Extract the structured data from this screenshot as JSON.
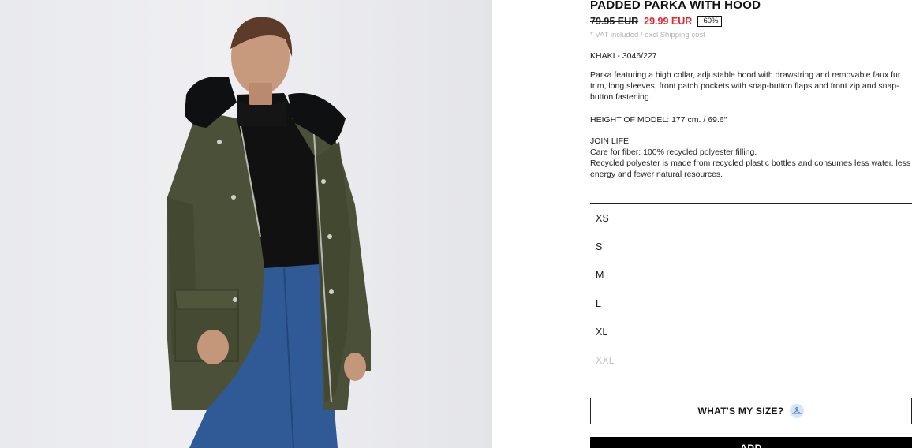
{
  "product": {
    "title": "PADDED PARKA WITH HOOD",
    "old_price": "79.95 EUR",
    "sale_price": "29.99 EUR",
    "discount": "-60%",
    "vat_note": "* VAT included / excl Shipping cost",
    "color_ref": "KHAKI - 3046/227",
    "description": "Parka featuring a high collar, adjustable hood with drawstring and removable faux fur trim, long sleeves, front patch pockets with snap-button flaps and front zip and snap-button fastening.",
    "model_height": "HEIGHT OF MODEL: 177 cm. / 69.6″",
    "join_life_title": "JOIN LIFE",
    "join_life_care": "Care for fiber: 100% recycled polyester filling.",
    "join_life_detail": "Recycled polyester is made from recycled plastic bottles and consumes less water, less energy and fewer natural resources."
  },
  "sizes": [
    {
      "label": "XS",
      "available": true
    },
    {
      "label": "S",
      "available": true
    },
    {
      "label": "M",
      "available": true
    },
    {
      "label": "L",
      "available": true
    },
    {
      "label": "XL",
      "available": true
    },
    {
      "label": "XXL",
      "available": false
    }
  ],
  "actions": {
    "whats_my_size": "WHAT'S MY SIZE?",
    "whats_my_size_icon": "hanger-icon",
    "add_label": "ADD"
  },
  "colors": {
    "sale_red": "#e3262e",
    "parka_khaki": "#4b5138",
    "jeans_blue": "#2f5a95"
  }
}
